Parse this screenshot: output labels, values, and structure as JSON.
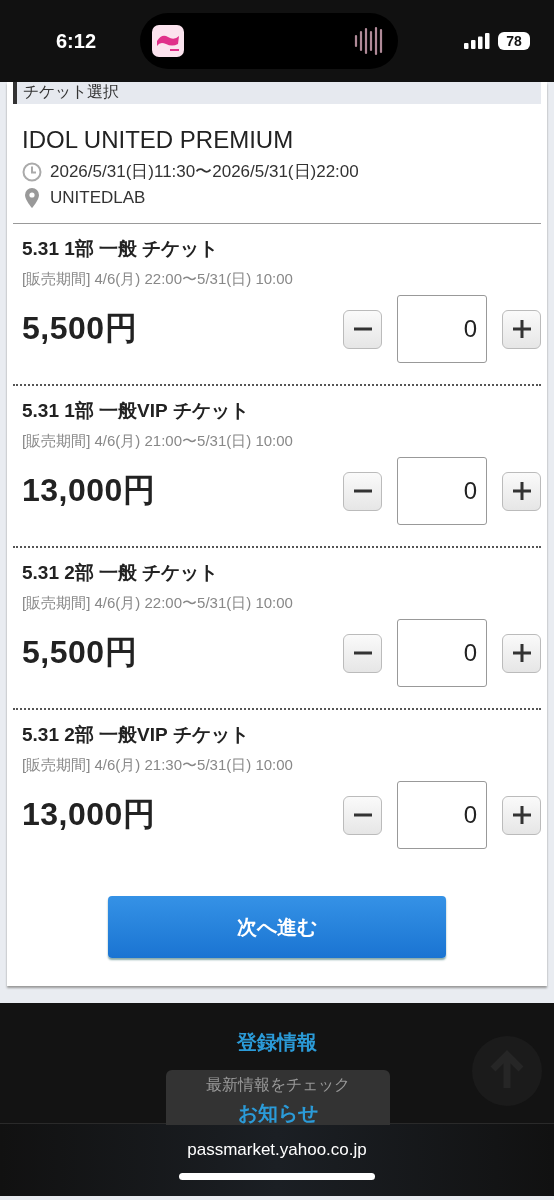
{
  "status_bar": {
    "time": "6:12",
    "battery": "78"
  },
  "section_title": "チケット選択",
  "event": {
    "title": "IDOL UNITED PREMIUM",
    "datetime": "2026/5/31(日)11:30〜2026/5/31(日)22:00",
    "venue": "UNITEDLAB"
  },
  "tickets": [
    {
      "name": "5.31 1部 一般 チケット",
      "period": "[販売期間] 4/6(月) 22:00〜5/31(日) 10:00",
      "price": "5,500円",
      "quantity": "0"
    },
    {
      "name": "5.31 1部 一般VIP チケット",
      "period": "[販売期間] 4/6(月) 21:00〜5/31(日) 10:00",
      "price": "13,000円",
      "quantity": "0"
    },
    {
      "name": "5.31 2部 一般 チケット",
      "period": "[販売期間] 4/6(月) 22:00〜5/31(日) 10:00",
      "price": "5,500円",
      "quantity": "0"
    },
    {
      "name": "5.31 2部 一般VIP チケット",
      "period": "[販売期間] 4/6(月) 21:30〜5/31(日) 10:00",
      "price": "13,000円",
      "quantity": "0"
    }
  ],
  "next_button": "次へ進む",
  "footer": {
    "link": "登録情報",
    "toast_caption": "最新情報をチェック",
    "toast_link": "お知らせ"
  },
  "url_bar": {
    "address": "passmarket.yahoo.co.jp"
  }
}
